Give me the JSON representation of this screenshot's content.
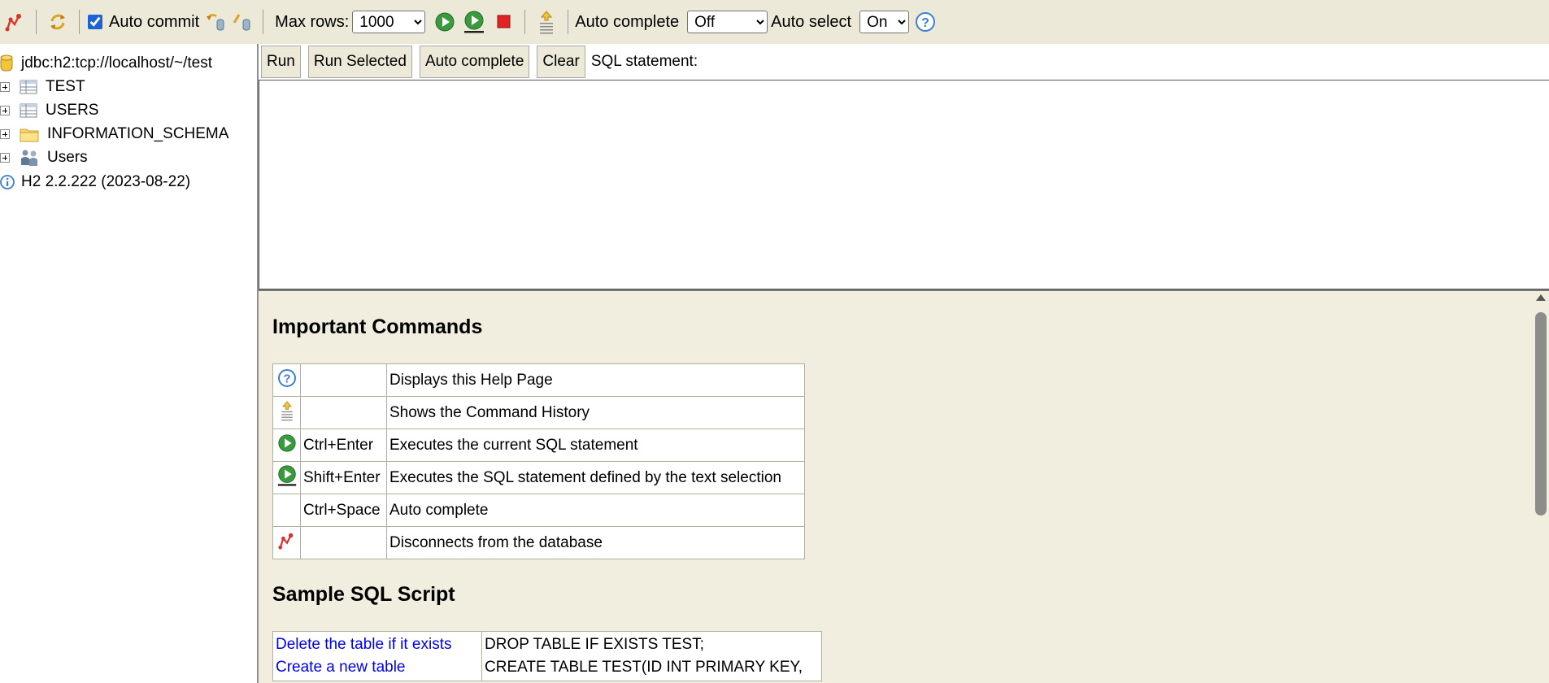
{
  "toolbar": {
    "auto_commit_label": "Auto commit",
    "auto_commit_checked": true,
    "max_rows_label": "Max rows:",
    "max_rows_value": "1000",
    "auto_complete_label": "Auto complete",
    "auto_complete_value": "Off",
    "auto_select_label": "Auto select",
    "auto_select_value": "On"
  },
  "tree": {
    "connection": "jdbc:h2:tcp://localhost/~/test",
    "items": [
      {
        "label": "TEST",
        "icon": "table-icon"
      },
      {
        "label": "USERS",
        "icon": "table-icon"
      },
      {
        "label": "INFORMATION_SCHEMA",
        "icon": "folder-icon"
      },
      {
        "label": "Users",
        "icon": "users-icon"
      }
    ],
    "version": "H2 2.2.222 (2023-08-22)"
  },
  "query": {
    "run_label": "Run",
    "run_selected_label": "Run Selected",
    "auto_complete_label": "Auto complete",
    "clear_label": "Clear",
    "sql_statement_label": "SQL statement:"
  },
  "help": {
    "important_title": "Important Commands",
    "commands": [
      {
        "icon": "help-icon",
        "key": "",
        "description": "Displays this Help Page"
      },
      {
        "icon": "history-icon",
        "key": "",
        "description": "Shows the Command History"
      },
      {
        "icon": "run-icon",
        "key": "Ctrl+Enter",
        "description": "Executes the current SQL statement"
      },
      {
        "icon": "run-selected-icon",
        "key": "Shift+Enter",
        "description": "Executes the SQL statement defined by the text selection"
      },
      {
        "icon": "",
        "key": "Ctrl+Space",
        "description": "Auto complete"
      },
      {
        "icon": "disconnect-icon",
        "key": "",
        "description": "Disconnects from the database"
      }
    ],
    "sample_title": "Sample SQL Script",
    "sample_links": [
      "Delete the table if it exists",
      "Create a new table"
    ],
    "sample_sql": [
      "DROP TABLE IF EXISTS TEST;",
      "CREATE TABLE TEST(ID INT PRIMARY KEY,"
    ]
  }
}
